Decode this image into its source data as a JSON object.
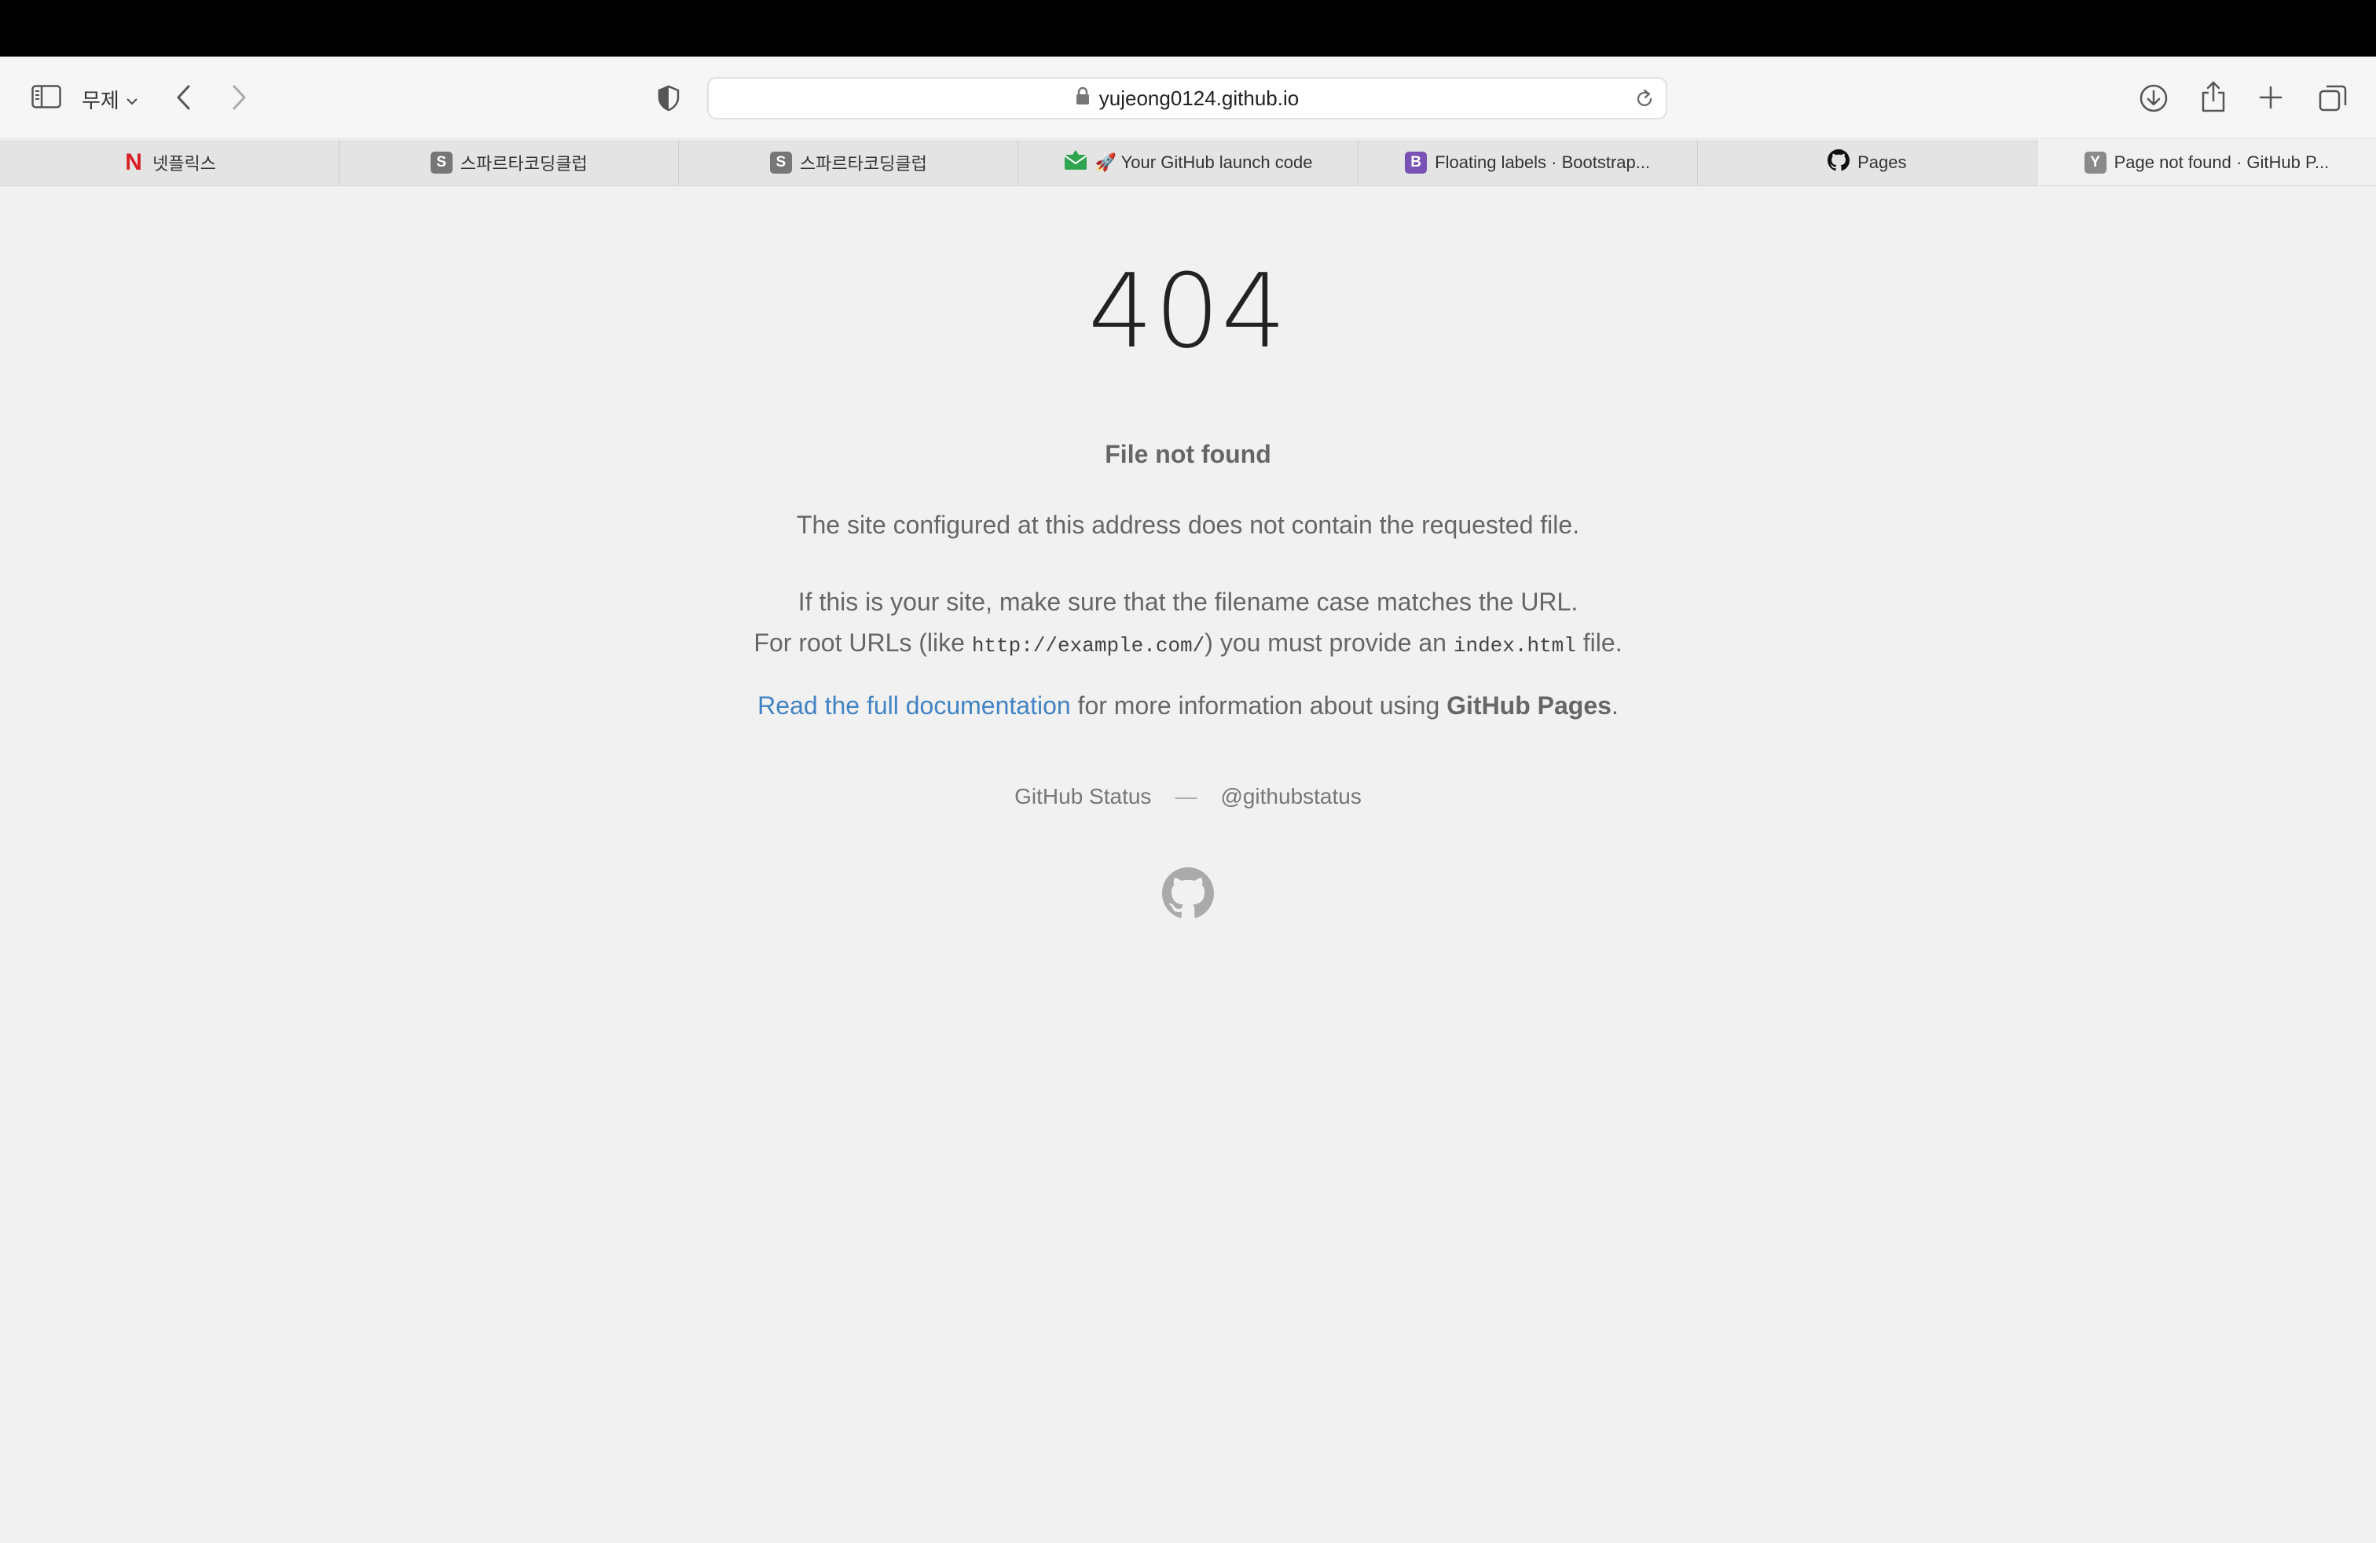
{
  "toolbar": {
    "profile_label": "무제",
    "url": "yujeong0124.github.io"
  },
  "tabs": [
    {
      "label": "넷플릭스",
      "favicon": "netflix-icon",
      "favicon_text": "N",
      "active": false
    },
    {
      "label": "스파르타코딩클럽",
      "favicon": "s-icon",
      "favicon_text": "S",
      "active": false
    },
    {
      "label": "스파르타코딩클럽",
      "favicon": "s-icon",
      "favicon_text": "S",
      "active": false
    },
    {
      "label": "🚀 Your GitHub launch code",
      "favicon": "mail-icon",
      "favicon_text": "",
      "active": false
    },
    {
      "label": "Floating labels · Bootstrap...",
      "favicon": "bootstrap-icon",
      "favicon_text": "B",
      "active": false
    },
    {
      "label": "Pages",
      "favicon": "github-icon",
      "favicon_text": "",
      "active": false
    },
    {
      "label": "Page not found · GitHub P...",
      "favicon": "y-icon",
      "favicon_text": "Y",
      "active": true
    }
  ],
  "page": {
    "code": "404",
    "heading": "File not found",
    "p1": "The site configured at this address does not contain the requested file.",
    "p2_line1": "If this is your site, make sure that the filename case matches the URL.",
    "p2_line2_a": "For root URLs (like ",
    "p2_line2_code1": "http://example.com/",
    "p2_line2_b": ") you must provide an ",
    "p2_line2_code2": "index.html",
    "p2_line2_c": " file.",
    "p3_link": "Read the full documentation",
    "p3_middle": " for more information about using ",
    "p3_bold": "GitHub Pages",
    "p3_end": ".",
    "footer_status": "GitHub Status",
    "footer_sep": "—",
    "footer_handle": "@githubstatus"
  },
  "colors": {
    "link": "#4183c4",
    "background": "#f1f1f1",
    "text": "#666666"
  }
}
